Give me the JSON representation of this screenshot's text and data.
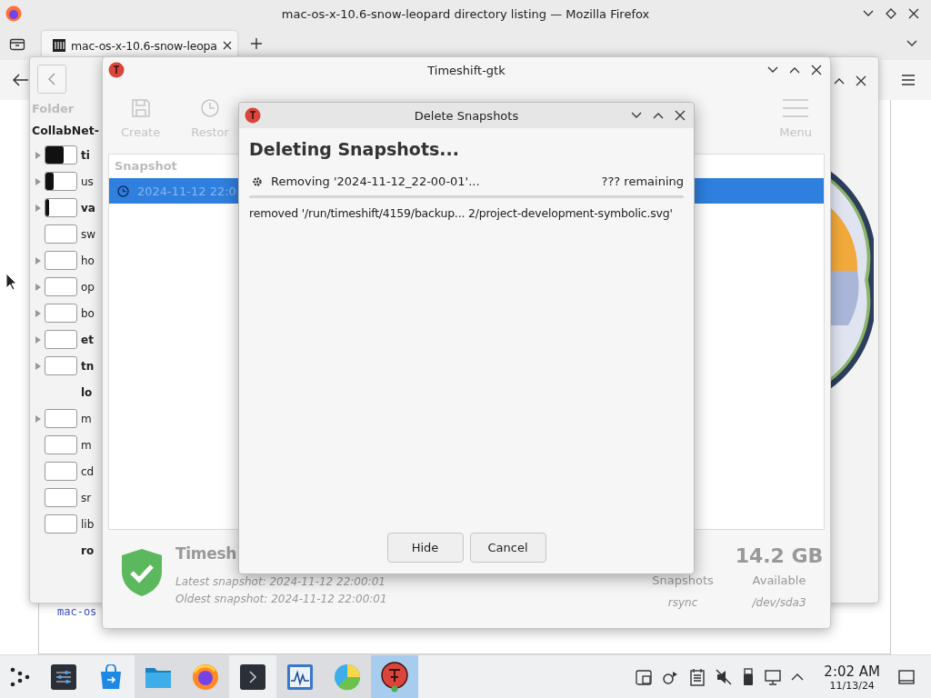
{
  "browser": {
    "title": "mac-os-x-10.6-snow-leopard directory listing — Mozilla Firefox",
    "tabs": [
      {
        "title": "mac-os-x-10.6-snow-leopa",
        "selected": true
      }
    ],
    "page_link": "mac-os"
  },
  "folder_window": {
    "header": "Folder",
    "root": "CollabNet-",
    "rows": [
      {
        "name": "ti",
        "bold": true,
        "expandable": true,
        "kind": "bar",
        "level": 0.6
      },
      {
        "name": "us",
        "bold": false,
        "expandable": true,
        "kind": "bar",
        "level": 0.25
      },
      {
        "name": "va",
        "bold": true,
        "expandable": true,
        "kind": "bar",
        "level": 0.12
      },
      {
        "name": "sw",
        "bold": false,
        "expandable": false,
        "kind": "bar",
        "level": 0
      },
      {
        "name": "ho",
        "bold": false,
        "expandable": true,
        "kind": "bar",
        "level": 0
      },
      {
        "name": "op",
        "bold": false,
        "expandable": true,
        "kind": "bar",
        "level": 0
      },
      {
        "name": "bo",
        "bold": false,
        "expandable": true,
        "kind": "bar",
        "level": 0
      },
      {
        "name": "et",
        "bold": true,
        "expandable": true,
        "kind": "bar",
        "level": 0
      },
      {
        "name": "tn",
        "bold": true,
        "expandable": true,
        "kind": "bar",
        "level": 0
      },
      {
        "name": "lo",
        "bold": true,
        "expandable": false,
        "kind": "plain"
      },
      {
        "name": "m",
        "bold": false,
        "expandable": true,
        "kind": "bar",
        "level": 0
      },
      {
        "name": "m",
        "bold": false,
        "expandable": false,
        "kind": "bar",
        "level": 0
      },
      {
        "name": "cd",
        "bold": false,
        "expandable": false,
        "kind": "bar",
        "level": 0
      },
      {
        "name": "sr",
        "bold": false,
        "expandable": false,
        "kind": "bar",
        "level": 0
      },
      {
        "name": "lib",
        "bold": false,
        "expandable": false,
        "kind": "bar",
        "level": 0
      },
      {
        "name": "ro",
        "bold": true,
        "expandable": false,
        "kind": "plain"
      }
    ]
  },
  "timeshift": {
    "title": "Timeshift-gtk",
    "toolbar": [
      {
        "kind": "save",
        "label": "Create",
        "disabled": true
      },
      {
        "kind": "clock",
        "label": "Restor",
        "disabled": true
      },
      {
        "kind": "menu",
        "label": "Menu",
        "disabled": true
      }
    ],
    "list_header": "Snapshot",
    "snapshots": [
      {
        "label": "2024-11-12 22:0",
        "selected": true
      }
    ],
    "status": {
      "title": "Timesh",
      "latest": "Latest snapshot: 2024-11-12 22:00:01",
      "oldest": "Oldest snapshot: 2024-11-12 22:00:01"
    },
    "stats": [
      {
        "label": "Snapshots",
        "detail": "rsync"
      },
      {
        "value": "14.2 GB",
        "label": "Available",
        "detail": "/dev/sda3"
      }
    ]
  },
  "dialog": {
    "title": "Delete Snapshots",
    "heading": "Deleting Snapshots...",
    "status": "Removing '2024-11-12_22-00-01'...",
    "remaining": "??? remaining",
    "level": 0,
    "log": "removed '/run/timeshift/4159/backup... 2/project-development-symbolic.svg'",
    "buttons": [
      "Hide",
      "Cancel"
    ]
  },
  "taskbar": {
    "apps": [
      {
        "kind": "launcher",
        "running": false,
        "selected": false
      },
      {
        "kind": "settings",
        "running": false,
        "selected": false
      },
      {
        "kind": "store",
        "running": false,
        "selected": false
      },
      {
        "kind": "files",
        "running": true,
        "selected": false
      },
      {
        "kind": "browser",
        "running": true,
        "selected": false
      },
      {
        "kind": "terminal",
        "running": false,
        "selected": false
      },
      {
        "kind": "monitor",
        "running": true,
        "selected": false
      },
      {
        "kind": "disk",
        "running": true,
        "selected": false
      },
      {
        "kind": "timeshift",
        "running": true,
        "selected": true
      }
    ],
    "tray": [
      {
        "kind": "clipboard"
      },
      {
        "kind": "network"
      },
      {
        "kind": "notes"
      },
      {
        "kind": "muted"
      },
      {
        "kind": "usb"
      },
      {
        "kind": "display"
      },
      {
        "kind": "expand"
      }
    ],
    "time": "2:02 AM",
    "date": "11/13/24"
  }
}
